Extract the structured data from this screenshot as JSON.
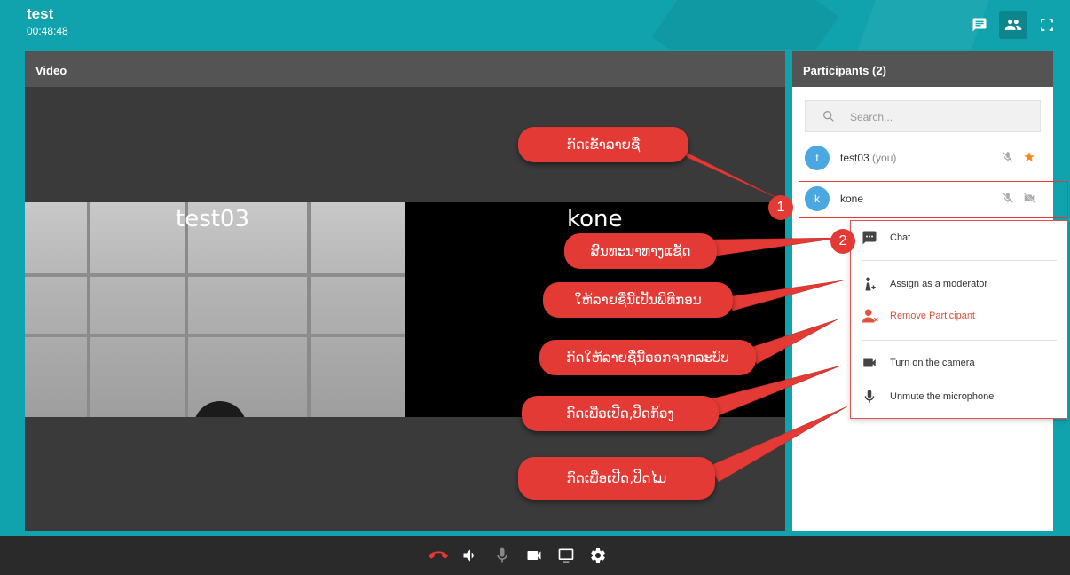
{
  "header": {
    "title": "test",
    "timer": "00:48:48",
    "icons": [
      "chat-icon",
      "participants-icon",
      "fullscreen-icon"
    ]
  },
  "video": {
    "panel_title": "Video",
    "feeds": [
      {
        "name": "test03"
      },
      {
        "name": "kone"
      }
    ]
  },
  "participants": {
    "title": "Participants (2)",
    "search_placeholder": "Search...",
    "list": [
      {
        "initial": "t",
        "name": "test03",
        "suffix": "(you)"
      },
      {
        "initial": "k",
        "name": "kone"
      }
    ]
  },
  "menu": {
    "items": [
      {
        "label": "Chat",
        "icon": "chat-icon"
      },
      {
        "label": "Assign as a moderator",
        "icon": "moderator-icon"
      },
      {
        "label": "Remove Participant",
        "icon": "remove-user-icon"
      },
      {
        "label": "Turn on the camera",
        "icon": "camera-icon"
      },
      {
        "label": "Unmute the microphone",
        "icon": "microphone-icon"
      }
    ]
  },
  "annotations": {
    "callouts": [
      "ກົດເຂົ້າລາຍຊື່",
      "ສົນທະນາທາງແຊັດ",
      "ໃຫ້ລາຍຊື່ນີ້ເປັນພິທີກອນ",
      "ກົດໃຫ້ລາຍຊື່ນີ້ອອກຈາກລະບົບ",
      "ກົດເພື່ອເປີດ,ປິດກ້ອງ",
      "ກົດເພື່ອເປີດ,ປິດໄມ"
    ],
    "badges": [
      "1",
      "2"
    ],
    "colors": {
      "callout": "#e33a35",
      "accent": "#11a3ad"
    }
  },
  "controls": [
    "hangup-icon",
    "volume-icon",
    "microphone-icon",
    "camera-icon",
    "screen-share-icon",
    "settings-icon"
  ]
}
